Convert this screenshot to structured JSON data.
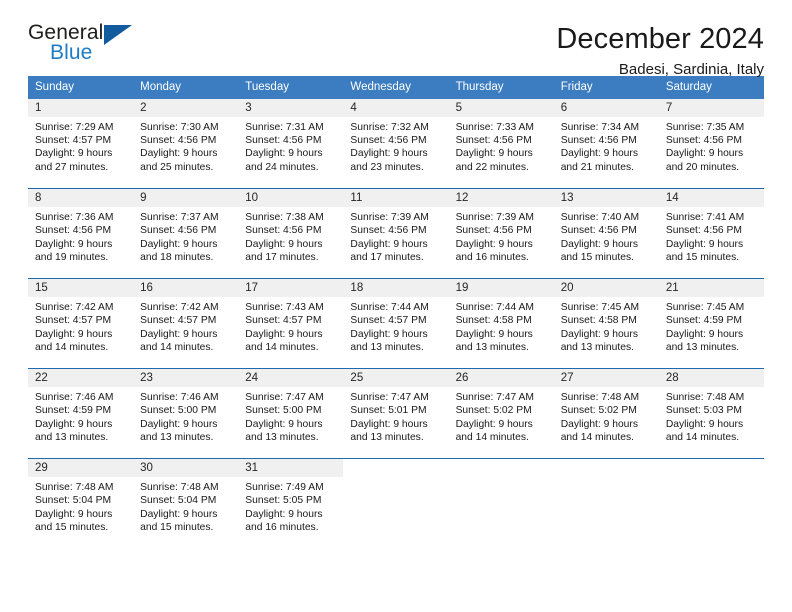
{
  "brand": {
    "word_one": "General",
    "word_two": "Blue",
    "flag_icon": "triangle-flag-icon"
  },
  "header": {
    "title": "December 2024",
    "location": "Badesi, Sardinia, Italy"
  },
  "calendar": {
    "weekday_headers": [
      "Sunday",
      "Monday",
      "Tuesday",
      "Wednesday",
      "Thursday",
      "Friday",
      "Saturday"
    ],
    "accent_color": "#3b7dc0",
    "border_color": "#1f6aae",
    "daynum_background": "#f0f0f0",
    "weeks": [
      [
        {
          "day": "1",
          "sunrise": "Sunrise: 7:29 AM",
          "sunset": "Sunset: 4:57 PM",
          "daylight_line1": "Daylight: 9 hours",
          "daylight_line2": "and 27 minutes."
        },
        {
          "day": "2",
          "sunrise": "Sunrise: 7:30 AM",
          "sunset": "Sunset: 4:56 PM",
          "daylight_line1": "Daylight: 9 hours",
          "daylight_line2": "and 25 minutes."
        },
        {
          "day": "3",
          "sunrise": "Sunrise: 7:31 AM",
          "sunset": "Sunset: 4:56 PM",
          "daylight_line1": "Daylight: 9 hours",
          "daylight_line2": "and 24 minutes."
        },
        {
          "day": "4",
          "sunrise": "Sunrise: 7:32 AM",
          "sunset": "Sunset: 4:56 PM",
          "daylight_line1": "Daylight: 9 hours",
          "daylight_line2": "and 23 minutes."
        },
        {
          "day": "5",
          "sunrise": "Sunrise: 7:33 AM",
          "sunset": "Sunset: 4:56 PM",
          "daylight_line1": "Daylight: 9 hours",
          "daylight_line2": "and 22 minutes."
        },
        {
          "day": "6",
          "sunrise": "Sunrise: 7:34 AM",
          "sunset": "Sunset: 4:56 PM",
          "daylight_line1": "Daylight: 9 hours",
          "daylight_line2": "and 21 minutes."
        },
        {
          "day": "7",
          "sunrise": "Sunrise: 7:35 AM",
          "sunset": "Sunset: 4:56 PM",
          "daylight_line1": "Daylight: 9 hours",
          "daylight_line2": "and 20 minutes."
        }
      ],
      [
        {
          "day": "8",
          "sunrise": "Sunrise: 7:36 AM",
          "sunset": "Sunset: 4:56 PM",
          "daylight_line1": "Daylight: 9 hours",
          "daylight_line2": "and 19 minutes."
        },
        {
          "day": "9",
          "sunrise": "Sunrise: 7:37 AM",
          "sunset": "Sunset: 4:56 PM",
          "daylight_line1": "Daylight: 9 hours",
          "daylight_line2": "and 18 minutes."
        },
        {
          "day": "10",
          "sunrise": "Sunrise: 7:38 AM",
          "sunset": "Sunset: 4:56 PM",
          "daylight_line1": "Daylight: 9 hours",
          "daylight_line2": "and 17 minutes."
        },
        {
          "day": "11",
          "sunrise": "Sunrise: 7:39 AM",
          "sunset": "Sunset: 4:56 PM",
          "daylight_line1": "Daylight: 9 hours",
          "daylight_line2": "and 17 minutes."
        },
        {
          "day": "12",
          "sunrise": "Sunrise: 7:39 AM",
          "sunset": "Sunset: 4:56 PM",
          "daylight_line1": "Daylight: 9 hours",
          "daylight_line2": "and 16 minutes."
        },
        {
          "day": "13",
          "sunrise": "Sunrise: 7:40 AM",
          "sunset": "Sunset: 4:56 PM",
          "daylight_line1": "Daylight: 9 hours",
          "daylight_line2": "and 15 minutes."
        },
        {
          "day": "14",
          "sunrise": "Sunrise: 7:41 AM",
          "sunset": "Sunset: 4:56 PM",
          "daylight_line1": "Daylight: 9 hours",
          "daylight_line2": "and 15 minutes."
        }
      ],
      [
        {
          "day": "15",
          "sunrise": "Sunrise: 7:42 AM",
          "sunset": "Sunset: 4:57 PM",
          "daylight_line1": "Daylight: 9 hours",
          "daylight_line2": "and 14 minutes."
        },
        {
          "day": "16",
          "sunrise": "Sunrise: 7:42 AM",
          "sunset": "Sunset: 4:57 PM",
          "daylight_line1": "Daylight: 9 hours",
          "daylight_line2": "and 14 minutes."
        },
        {
          "day": "17",
          "sunrise": "Sunrise: 7:43 AM",
          "sunset": "Sunset: 4:57 PM",
          "daylight_line1": "Daylight: 9 hours",
          "daylight_line2": "and 14 minutes."
        },
        {
          "day": "18",
          "sunrise": "Sunrise: 7:44 AM",
          "sunset": "Sunset: 4:57 PM",
          "daylight_line1": "Daylight: 9 hours",
          "daylight_line2": "and 13 minutes."
        },
        {
          "day": "19",
          "sunrise": "Sunrise: 7:44 AM",
          "sunset": "Sunset: 4:58 PM",
          "daylight_line1": "Daylight: 9 hours",
          "daylight_line2": "and 13 minutes."
        },
        {
          "day": "20",
          "sunrise": "Sunrise: 7:45 AM",
          "sunset": "Sunset: 4:58 PM",
          "daylight_line1": "Daylight: 9 hours",
          "daylight_line2": "and 13 minutes."
        },
        {
          "day": "21",
          "sunrise": "Sunrise: 7:45 AM",
          "sunset": "Sunset: 4:59 PM",
          "daylight_line1": "Daylight: 9 hours",
          "daylight_line2": "and 13 minutes."
        }
      ],
      [
        {
          "day": "22",
          "sunrise": "Sunrise: 7:46 AM",
          "sunset": "Sunset: 4:59 PM",
          "daylight_line1": "Daylight: 9 hours",
          "daylight_line2": "and 13 minutes."
        },
        {
          "day": "23",
          "sunrise": "Sunrise: 7:46 AM",
          "sunset": "Sunset: 5:00 PM",
          "daylight_line1": "Daylight: 9 hours",
          "daylight_line2": "and 13 minutes."
        },
        {
          "day": "24",
          "sunrise": "Sunrise: 7:47 AM",
          "sunset": "Sunset: 5:00 PM",
          "daylight_line1": "Daylight: 9 hours",
          "daylight_line2": "and 13 minutes."
        },
        {
          "day": "25",
          "sunrise": "Sunrise: 7:47 AM",
          "sunset": "Sunset: 5:01 PM",
          "daylight_line1": "Daylight: 9 hours",
          "daylight_line2": "and 13 minutes."
        },
        {
          "day": "26",
          "sunrise": "Sunrise: 7:47 AM",
          "sunset": "Sunset: 5:02 PM",
          "daylight_line1": "Daylight: 9 hours",
          "daylight_line2": "and 14 minutes."
        },
        {
          "day": "27",
          "sunrise": "Sunrise: 7:48 AM",
          "sunset": "Sunset: 5:02 PM",
          "daylight_line1": "Daylight: 9 hours",
          "daylight_line2": "and 14 minutes."
        },
        {
          "day": "28",
          "sunrise": "Sunrise: 7:48 AM",
          "sunset": "Sunset: 5:03 PM",
          "daylight_line1": "Daylight: 9 hours",
          "daylight_line2": "and 14 minutes."
        }
      ],
      [
        {
          "day": "29",
          "sunrise": "Sunrise: 7:48 AM",
          "sunset": "Sunset: 5:04 PM",
          "daylight_line1": "Daylight: 9 hours",
          "daylight_line2": "and 15 minutes."
        },
        {
          "day": "30",
          "sunrise": "Sunrise: 7:48 AM",
          "sunset": "Sunset: 5:04 PM",
          "daylight_line1": "Daylight: 9 hours",
          "daylight_line2": "and 15 minutes."
        },
        {
          "day": "31",
          "sunrise": "Sunrise: 7:49 AM",
          "sunset": "Sunset: 5:05 PM",
          "daylight_line1": "Daylight: 9 hours",
          "daylight_line2": "and 16 minutes."
        },
        {
          "day": "",
          "sunrise": "",
          "sunset": "",
          "daylight_line1": "",
          "daylight_line2": ""
        },
        {
          "day": "",
          "sunrise": "",
          "sunset": "",
          "daylight_line1": "",
          "daylight_line2": ""
        },
        {
          "day": "",
          "sunrise": "",
          "sunset": "",
          "daylight_line1": "",
          "daylight_line2": ""
        },
        {
          "day": "",
          "sunrise": "",
          "sunset": "",
          "daylight_line1": "",
          "daylight_line2": ""
        }
      ]
    ]
  }
}
